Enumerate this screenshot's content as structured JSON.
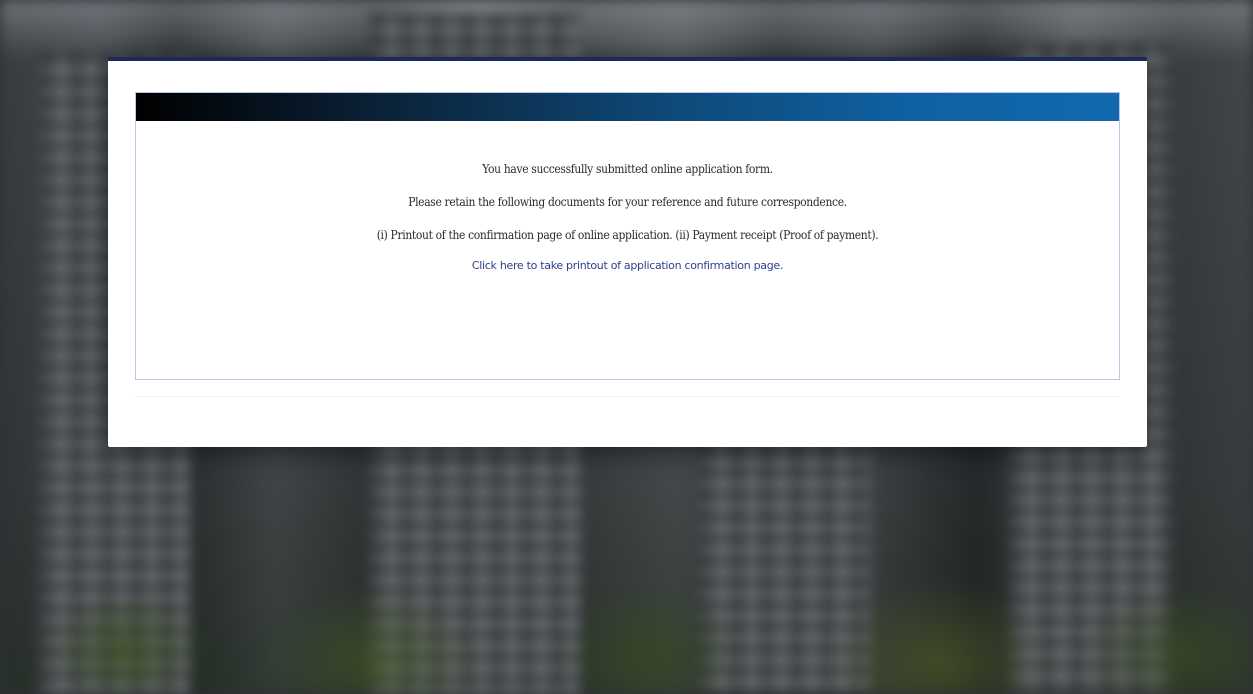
{
  "confirmation": {
    "line1": "You have successfully submitted online application form.",
    "line2": "Please retain the following documents for your reference and future correspondence.",
    "line3": "(i) Printout of the confirmation page of online application.  (ii) Payment receipt (Proof of payment).",
    "print_link": "Click here to take printout of application confirmation page."
  },
  "colors": {
    "modal_border": "#1b2a57",
    "header_gradient_start": "#000000",
    "header_gradient_end": "#1269ad",
    "link": "#2f3f8f"
  }
}
